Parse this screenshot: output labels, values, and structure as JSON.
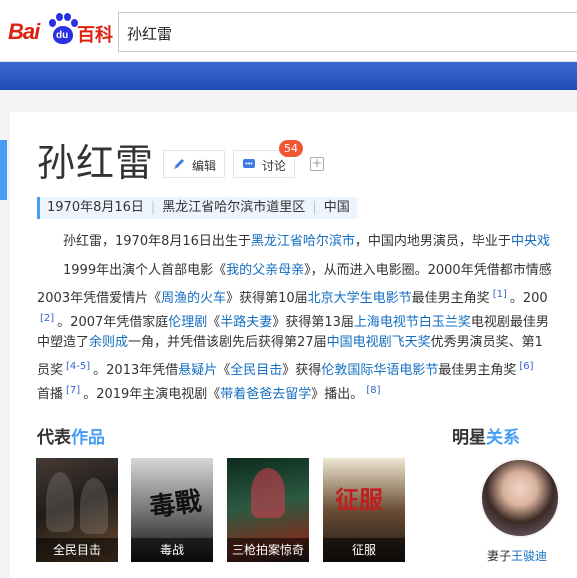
{
  "header": {
    "logo_bai": "Bai",
    "logo_du": "du",
    "logo_baike": "百科",
    "search_value": "孙红雷"
  },
  "entry": {
    "title": "孙红雷",
    "edit_label": "编辑",
    "discuss_label": "讨论",
    "discuss_count": "54",
    "add_symbol": "+",
    "meta": [
      "1970年8月16日",
      "黑龙江省哈尔滨市道里区",
      "中国"
    ]
  },
  "paragraphs": {
    "p1": {
      "t1": "孙红雷，1970年8月16日出生于",
      "l1": "黑龙江省哈尔滨市",
      "t2": "，中国内地男演员，毕业于",
      "l2": "中央戏"
    },
    "p2a": {
      "t1": "1999年出演个人首部电影《",
      "l1": "我的父亲母亲",
      "t2": "》，从而进入电影圈。2000年凭借都市情感"
    },
    "p2b": {
      "t1": "2003年凭借爱情片《",
      "l1": "周渔的火车",
      "t2": "》获得第10届",
      "l2": "北京大学生电影节",
      "t3": "最佳男主角奖",
      "s1": "[1]",
      "t4": "。200"
    },
    "p2c": {
      "s1": "[2]",
      "t1": "。2007年凭借家庭",
      "l1": "伦理剧",
      "t2": "《",
      "l2": "半路夫妻",
      "t3": "》获得第13届",
      "l3": "上海电视节白玉兰奖",
      "t4": "电视剧最佳男"
    },
    "p2d": {
      "t1": "中塑造了",
      "l1": "余则成",
      "t2": "一角，并凭借该剧先后获得第27届",
      "l2": "中国电视剧飞天奖",
      "t3": "优秀男演员奖、第1"
    },
    "p2e": {
      "t1": "员奖",
      "s1": "[4-5]",
      "t2": "。2013年凭借",
      "l1": "悬疑片",
      "t3": "《",
      "l2": "全民目击",
      "t4": "》获得",
      "l3": "伦敦国际华语电影节",
      "t5": "最佳男主角奖",
      "s2": "[6]"
    },
    "p2f": {
      "t1": "首播",
      "s1": "[7]",
      "t2": "。2019年主演电视剧《",
      "l1": "带着爸爸去留学",
      "t3": "》播出。",
      "s2": "[8]"
    }
  },
  "works_section": {
    "title_plain": "代表",
    "title_highlight": "作品",
    "items": [
      {
        "caption": "全民目击"
      },
      {
        "caption": "毒战",
        "poster_text": "毒戰"
      },
      {
        "caption": "三枪拍案惊奇"
      },
      {
        "caption": "征服",
        "poster_text": "征服"
      }
    ]
  },
  "relations_section": {
    "title_plain": "明星",
    "title_highlight": "关系",
    "relation_label": "妻子",
    "relation_name": "王骏迪"
  },
  "colors": {
    "brand_red": "#de2110",
    "brand_blue": "#2932e1",
    "link_blue": "#136ec2",
    "accent_blue": "#459df5",
    "badge_orange": "#f15533"
  }
}
